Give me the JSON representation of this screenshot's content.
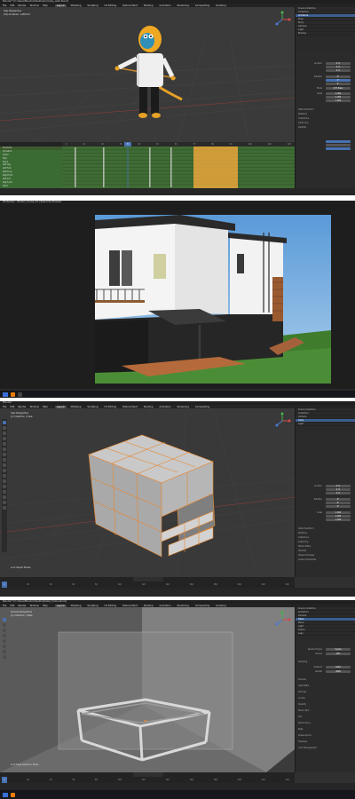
{
  "panel1": {
    "title": "Blender* [C:\\Users\\Blender\\Desktop\\monkey_walk.blend]",
    "menu": [
      "File",
      "Edit",
      "Render",
      "Window",
      "Help"
    ],
    "tabs": [
      "Layout",
      "Modeling",
      "Sculpting",
      "UV Editing",
      "Texture Paint",
      "Shading",
      "Animation",
      "Rendering",
      "Compositing",
      "Scripting"
    ],
    "active_tab": "Layout",
    "viewport_info": "User Perspective",
    "viewport_sub": "(34) Armature : Left.Foot",
    "outliner_rows": [
      "Scene Collection",
      "Collection",
      "Armature",
      "Pose",
      "Body",
      "Camera",
      "Light",
      "Monkey"
    ],
    "props_labels": [
      "Location",
      "Rotation",
      "Scale",
      "Mode",
      "Delta Transform",
      "Relations",
      "Collections",
      "Instancing",
      "Visibility"
    ],
    "props_values": [
      "0 m",
      "0 m",
      "0 m",
      "0°",
      "0°",
      "0°",
      "1.000",
      "1.000",
      "1.000",
      "XYZ Euler"
    ],
    "dopesheet_rows": [
      "Summary",
      "Armature",
      "Action",
      "Hips",
      "Spine",
      "Left.Leg",
      "Left.Foot",
      "Right.Leg",
      "Right.Foot",
      "Left.Arm",
      "Right.Arm",
      "Head"
    ],
    "frames": [
      "0",
      "10",
      "20",
      "30",
      "40",
      "50",
      "60",
      "70",
      "80",
      "90",
      "100",
      "110",
      "120"
    ],
    "current_frame": "34"
  },
  "panel2": {
    "title": "D5 Render - Modern_House_01 | Real-time Preview"
  },
  "panel3": {
    "title": "Blender",
    "menu": [
      "File",
      "Edit",
      "Render",
      "Window",
      "Help"
    ],
    "tabs": [
      "Layout",
      "Modeling",
      "Sculpting",
      "UV Editing",
      "Texture Paint",
      "Shading",
      "Animation",
      "Rendering",
      "Compositing"
    ],
    "active_tab": "Layout",
    "viewport_info": "User Perspective",
    "viewport_sub": "(1) Collection | Cube",
    "outliner_rows": [
      "Scene Collection",
      "Collection",
      "Camera",
      "Cube",
      "Light"
    ],
    "props_labels": [
      "Location",
      "Rotation",
      "Scale",
      "Delta Transform",
      "Relations",
      "Collections",
      "Instancing",
      "Motion Paths",
      "Visibility",
      "Viewport Display",
      "Custom Properties"
    ],
    "props_values": [
      "0 m",
      "0 m",
      "0 m",
      "0°",
      "0°",
      "0°",
      "1.000",
      "1.000",
      "1.000"
    ],
    "hint": "Lock Object Modes",
    "frames": [
      "0",
      "20",
      "40",
      "60",
      "80",
      "100",
      "120",
      "140",
      "160",
      "180",
      "200",
      "220",
      "240"
    ],
    "current_frame": "1"
  },
  "panel4": {
    "title": "Blender* [C:\\Users\\Blender\\Desktop\\table_frame.blend]",
    "menu": [
      "File",
      "Edit",
      "Render",
      "Window",
      "Help"
    ],
    "tabs": [
      "Layout",
      "Modeling",
      "Sculpting",
      "UV Editing",
      "Texture Paint",
      "Shading",
      "Animation",
      "Rendering",
      "Compositing",
      "Scripting"
    ],
    "active_tab": "Layout",
    "viewport_info": "Camera Perspective",
    "viewport_sub": "(1) Collection | Table",
    "outliner_rows": [
      "Scene Collection",
      "Collection",
      "Camera",
      "Table",
      "Plane",
      "Light",
      "Frame",
      "Legs"
    ],
    "props_labels": [
      "Render Engine",
      "Device",
      "Sampling",
      "Viewport",
      "Render",
      "Denoise",
      "Light Paths",
      "Volumes",
      "Curves",
      "Simplify",
      "Motion Blur",
      "Film",
      "Performance",
      "Bake",
      "Grease Pencil",
      "Freestyle",
      "Color Management"
    ],
    "props_values": [
      "Cycles",
      "CPU",
      "1024",
      "4096"
    ],
    "hint": "Lock Edge Selection Mode",
    "frames": [
      "0",
      "20",
      "40",
      "60",
      "80",
      "100",
      "120",
      "140",
      "160",
      "180",
      "200",
      "220",
      "240"
    ],
    "current_frame": "1"
  },
  "colors": {
    "accent": "#4772b3",
    "keyframe": "#e8a53a",
    "selection": "#e8862e",
    "grass": "#3f7d2d"
  }
}
